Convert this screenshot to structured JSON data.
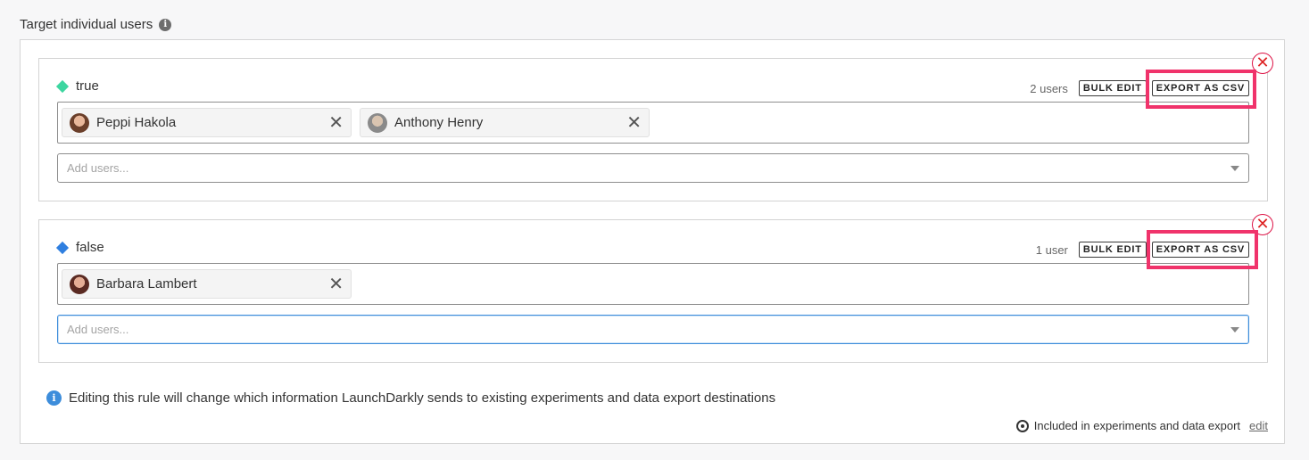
{
  "section": {
    "title": "Target individual users"
  },
  "variations": [
    {
      "name": "true",
      "color": "#3dd6a0",
      "count": "2 users",
      "bulk_edit": "BULK EDIT",
      "export_csv": "EXPORT AS CSV",
      "users": [
        "Peppi Hakola",
        "Anthony Henry"
      ],
      "add_placeholder": "Add users..."
    },
    {
      "name": "false",
      "color": "#2f7fe0",
      "count": "1 user",
      "bulk_edit": "BULK EDIT",
      "export_csv": "EXPORT AS CSV",
      "users": [
        "Barbara Lambert"
      ],
      "add_placeholder": "Add users..."
    }
  ],
  "notice": {
    "text": "Editing this rule will change which information LaunchDarkly sends to existing experiments and data export destinations"
  },
  "footer": {
    "text": "Included in experiments and data export",
    "edit_label": "edit"
  },
  "icons": {
    "info": "info-icon",
    "remove": "close-circle-icon",
    "chip_remove": "close-icon",
    "dropdown": "chevron-down-icon",
    "target": "target-icon"
  },
  "colors": {
    "highlight": "#f0336b",
    "focus": "#3d8ddb",
    "remove": "#dd2222"
  }
}
